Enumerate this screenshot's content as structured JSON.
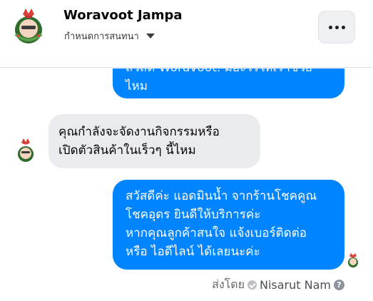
{
  "header": {
    "name": "Woravoot Jampa",
    "subtitle": "กำหนดการสนทนา",
    "more_label": "···"
  },
  "messages": {
    "prev_outgoing": {
      "line1": "สวัสดี Woravoot. มีอะไรให้เราช่วย",
      "line2": "ไหม"
    },
    "incoming": {
      "line1": "คุณกำลังจะจัดงานกิจกรรมหรือ",
      "line2": "เปิดตัวสินค้าในเร็วๆ นี้ไหม"
    },
    "outgoing": {
      "line1": "สวัสดีค่ะ แอดมินน้ำ จากร้านโชคคูณ",
      "line2": "โชคอุดร ยินดีให้บริการค่ะ",
      "line3": "หากคุณลูกค้าสนใจ แจ้งเบอร์ติดต่อ",
      "line4": "หรือ ไอดีไลน์ ได้เลยนะค่ะ"
    }
  },
  "sent_by": {
    "label": "ส่งโดย",
    "name": "Nisarut Nam",
    "help": "?"
  },
  "colors": {
    "outgoing_bubble": "#0084ff",
    "incoming_bubble": "#e9ebee"
  },
  "icons": {
    "more": "ellipsis-icon",
    "dropdown": "caret-down-icon",
    "sender_check": "check-circle-icon",
    "help": "question-icon"
  }
}
